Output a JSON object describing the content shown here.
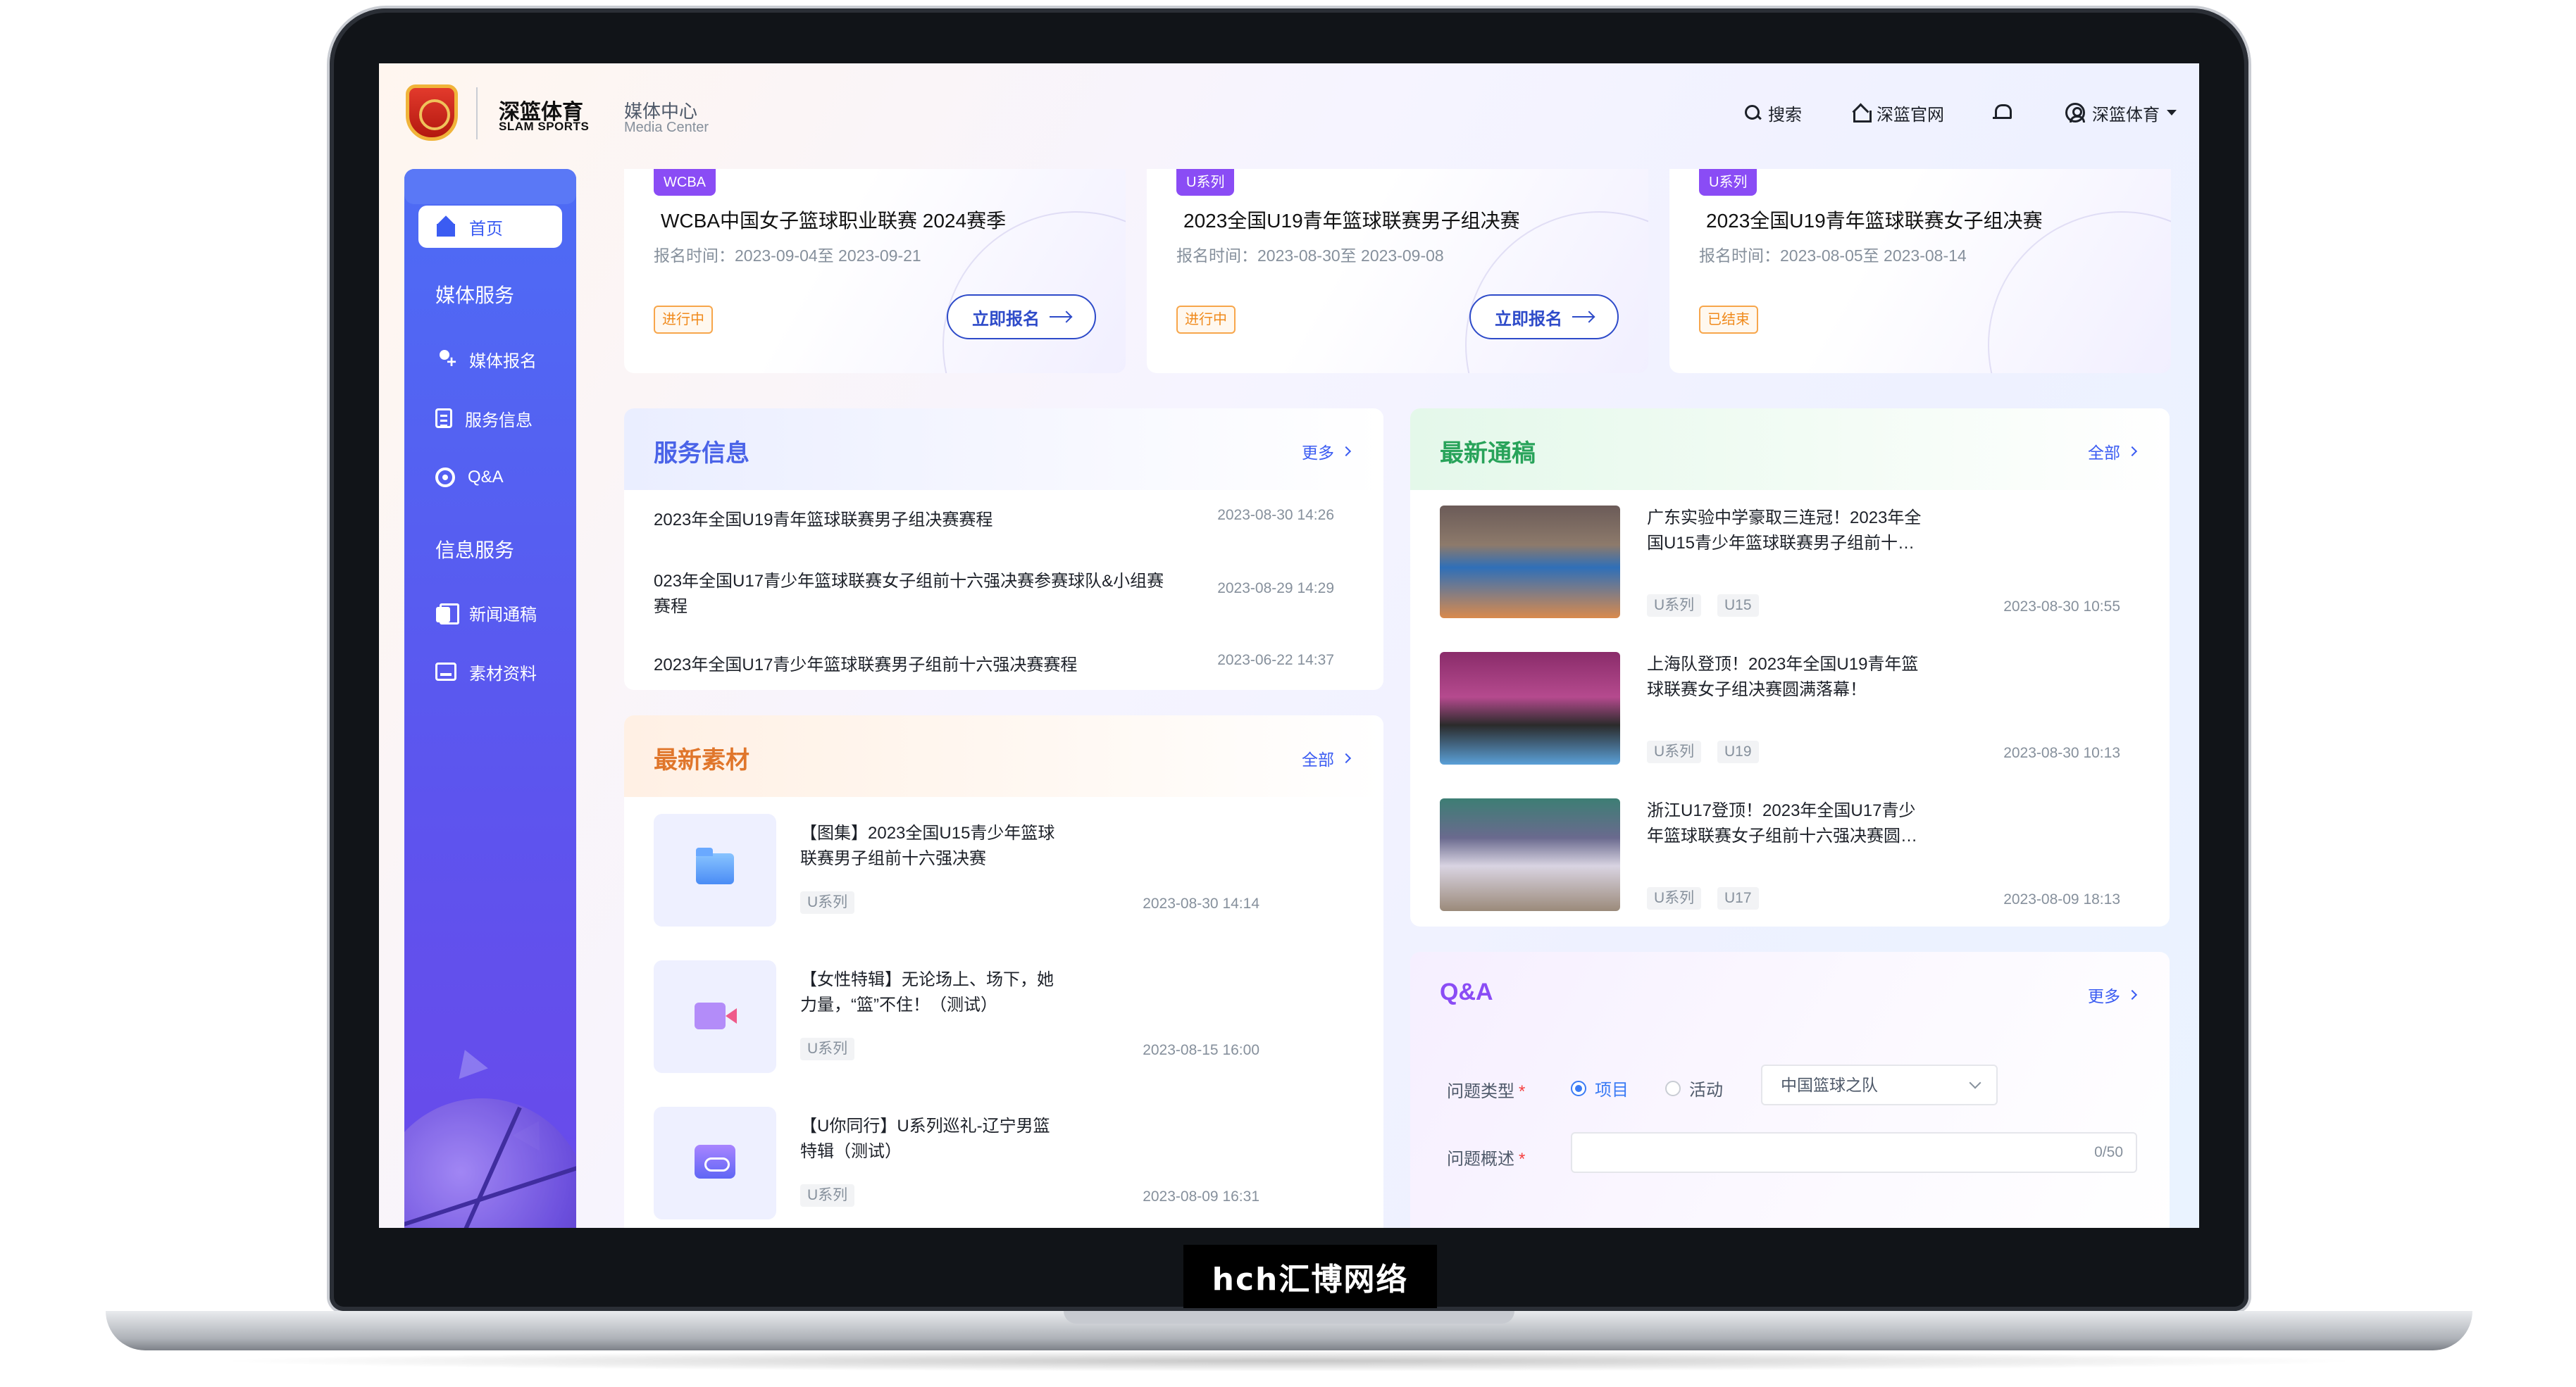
{
  "brand": {
    "name": "深篮体育",
    "name_en": "SLAM SPORTS",
    "section": "媒体中心",
    "section_en": "Media Center"
  },
  "watermark": "hch汇博网络",
  "topnav": {
    "search": "搜索",
    "official_site": "深篮官网",
    "user": "深篮体育"
  },
  "icons": {
    "search": "search-icon",
    "home": "home-icon",
    "bell": "bell-icon",
    "user": "user-icon",
    "dropdown": "chevron-down-icon"
  },
  "sidebar": {
    "home": "首页",
    "media_group": "媒体服务",
    "media_items": [
      "媒体报名",
      "服务信息",
      "Q&A"
    ],
    "info_group": "信息服务",
    "info_items": [
      "新闻通稿",
      "素材资料"
    ]
  },
  "events": [
    {
      "tag": "WCBA",
      "title": "WCBA中国女子篮球职业联赛 2024赛季",
      "time": "报名时间：2023-09-04至 2023-09-21",
      "status": "进行中",
      "button": "立即报名"
    },
    {
      "tag": "U系列",
      "title": "2023全国U19青年篮球联赛男子组决赛",
      "time": "报名时间：2023-08-30至 2023-09-08",
      "status": "进行中",
      "button": "立即报名"
    },
    {
      "tag": "U系列",
      "title": "2023全国U19青年篮球联赛女子组决赛",
      "time": "报名时间：2023-08-05至 2023-08-14",
      "status": "已结束"
    }
  ],
  "service_info": {
    "title": "服务信息",
    "more": "更多",
    "items": [
      {
        "title": "2023年全国U19青年篮球联赛男子组决赛赛程",
        "date": "2023-08-30 14:26"
      },
      {
        "title": "023年全国U17青少年篮球联赛女子组前十六强决赛参赛球队&小组赛",
        "title2": "赛程",
        "date": "2023-08-29 14:29"
      },
      {
        "title": "2023年全国U17青少年篮球联赛男子组前十六强决赛赛程",
        "date": "2023-06-22 14:37"
      }
    ]
  },
  "materials": {
    "title": "最新素材",
    "more": "全部",
    "items": [
      {
        "title": "【图集】2023全国U15青少年篮球",
        "title2": "联赛男子组前十六强决赛",
        "tag": "U系列",
        "date": "2023-08-30 14:14"
      },
      {
        "title": "【女性特辑】无论场上、场下，她",
        "title2": "力量，“篮”不住！（测试）",
        "tag": "U系列",
        "date": "2023-08-15 16:00"
      },
      {
        "title": "【U你同行】U系列巡礼-辽宁男篮",
        "title2": "特辑（测试）",
        "tag": "U系列",
        "date": "2023-08-09 16:31"
      }
    ]
  },
  "news": {
    "title": "最新通稿",
    "more": "全部",
    "items": [
      {
        "title": "广东实验中学豪取三连冠！2023年全",
        "title2": "国U15青少年篮球联赛男子组前十…",
        "tags": [
          "U系列",
          "U15"
        ],
        "date": "2023-08-30 10:55"
      },
      {
        "title": "上海队登顶！2023年全国U19青年篮",
        "title2": "球联赛女子组决赛圆满落幕！",
        "tags": [
          "U系列",
          "U19"
        ],
        "date": "2023-08-30 10:13"
      },
      {
        "title": "浙江U17登顶！2023年全国U17青少",
        "title2": "年篮球联赛女子组前十六强决赛圆…",
        "tags": [
          "U系列",
          "U17"
        ],
        "date": "2023-08-09 18:13"
      }
    ]
  },
  "qa": {
    "title": "Q&A",
    "more": "更多",
    "type_label": "问题类型",
    "required": "*",
    "option_project": "项目",
    "option_activity": "活动",
    "select_value": "中国篮球之队",
    "desc_label": "问题概述",
    "counter": "0/50"
  }
}
